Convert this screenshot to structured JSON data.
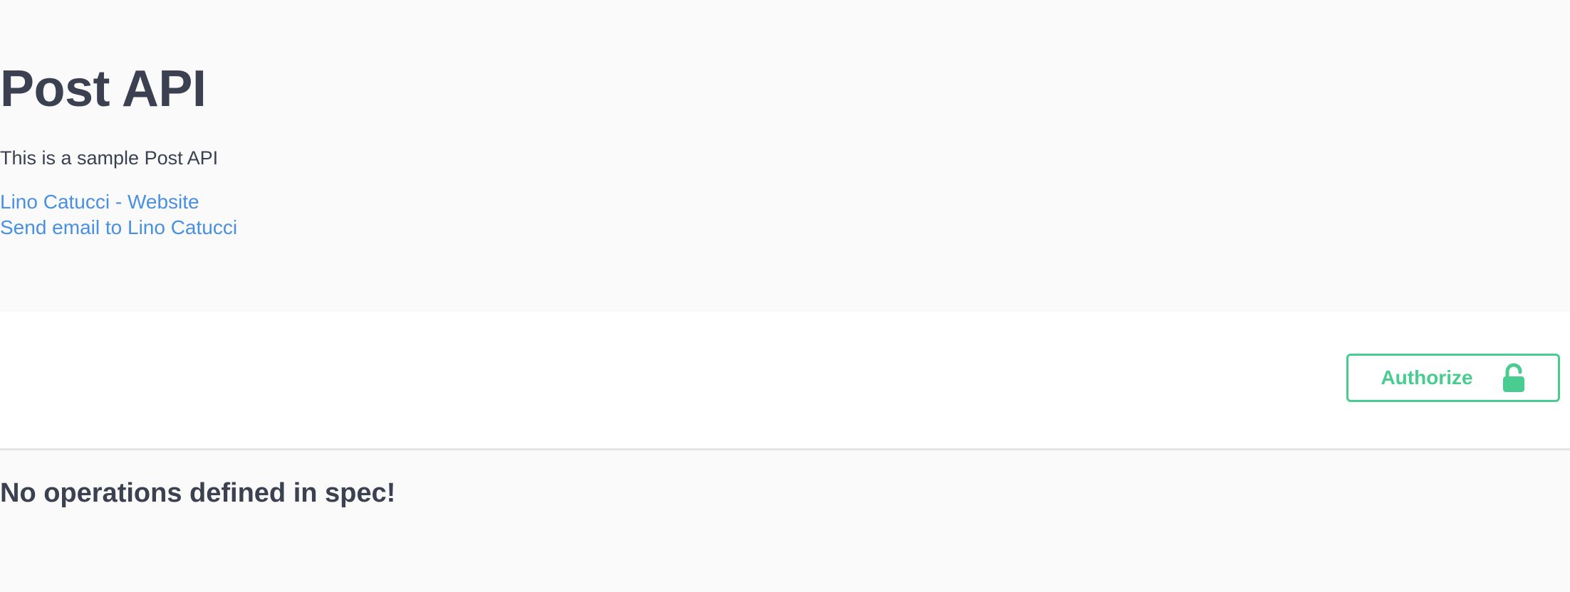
{
  "info": {
    "title": "Post API",
    "description": "This is a sample Post API",
    "links": [
      {
        "label": "Lino Catucci - Website"
      },
      {
        "label": "Send email to Lino Catucci"
      }
    ]
  },
  "scheme": {
    "authorize_label": "Authorize",
    "authorize_icon": "unlocked-padlock-icon",
    "accent_color": "#49cc90"
  },
  "operations": {
    "empty_message": "No operations defined in spec!"
  }
}
